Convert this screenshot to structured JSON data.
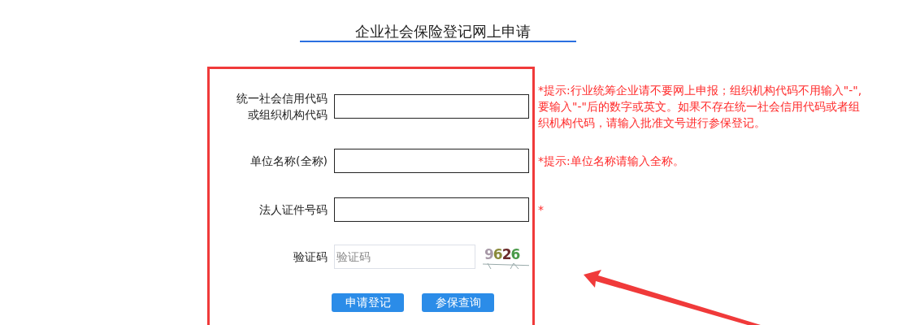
{
  "title": "企业社会保险登记网上申请",
  "fields": [
    {
      "kind": "text",
      "label": [
        "统一社会信用代码",
        "或组织机构代码"
      ],
      "hint": "*提示:行业统筹企业请不要网上申报；组织机构代码不用输入\"-\",要输入\"-\"后的数字或英文。如果不存在统一社会信用代码或者组织机构代码，请输入批准文号进行参保登记。"
    },
    {
      "kind": "text",
      "label": [
        "单位名称(全称)"
      ],
      "hint": "*提示:单位名称请输入全称。"
    },
    {
      "kind": "text",
      "label": [
        "法人证件号码"
      ],
      "hint": "*"
    },
    {
      "kind": "captcha",
      "label": [
        "验证码"
      ],
      "placeholder": "验证码",
      "captcha": "9626"
    }
  ],
  "buttons": [
    "申请登记",
    "参保查询"
  ]
}
